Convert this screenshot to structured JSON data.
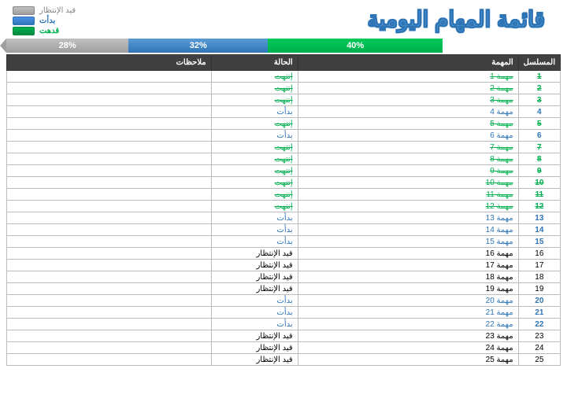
{
  "title": "قائمة المهام اليومية",
  "legend": {
    "pending": "قيد الإنتظار",
    "started": "بدأت",
    "done": "قدهت"
  },
  "progress": {
    "green": "40%",
    "blue": "32%",
    "gray": "28%"
  },
  "columns": {
    "seq": "المسلسل",
    "task": "المهمة",
    "status": "الحالة",
    "notes": "ملاحظات"
  },
  "status_labels": {
    "done": "إنتهت",
    "started": "بدأت",
    "pending": "قيد الإنتظار"
  },
  "rows": [
    {
      "n": 1,
      "task": "مهمة 1",
      "s": "done"
    },
    {
      "n": 2,
      "task": "مهمة 2",
      "s": "done"
    },
    {
      "n": 3,
      "task": "مهمة 3",
      "s": "done"
    },
    {
      "n": 4,
      "task": "مهمة 4",
      "s": "started"
    },
    {
      "n": 5,
      "task": "مهمة 5",
      "s": "done"
    },
    {
      "n": 6,
      "task": "مهمة 6",
      "s": "started"
    },
    {
      "n": 7,
      "task": "مهمة 7",
      "s": "done"
    },
    {
      "n": 8,
      "task": "مهمة 8",
      "s": "done"
    },
    {
      "n": 9,
      "task": "مهمة 9",
      "s": "done"
    },
    {
      "n": 10,
      "task": "مهمة 10",
      "s": "done"
    },
    {
      "n": 11,
      "task": "مهمة 11",
      "s": "done"
    },
    {
      "n": 12,
      "task": "مهمة 12",
      "s": "done"
    },
    {
      "n": 13,
      "task": "مهمة 13",
      "s": "started"
    },
    {
      "n": 14,
      "task": "مهمة 14",
      "s": "started"
    },
    {
      "n": 15,
      "task": "مهمة 15",
      "s": "started"
    },
    {
      "n": 16,
      "task": "مهمة 16",
      "s": "pending"
    },
    {
      "n": 17,
      "task": "مهمة 17",
      "s": "pending"
    },
    {
      "n": 18,
      "task": "مهمة 18",
      "s": "pending"
    },
    {
      "n": 19,
      "task": "مهمة 19",
      "s": "pending"
    },
    {
      "n": 20,
      "task": "مهمة 20",
      "s": "started"
    },
    {
      "n": 21,
      "task": "مهمة 21",
      "s": "started"
    },
    {
      "n": 22,
      "task": "مهمة 22",
      "s": "started"
    },
    {
      "n": 23,
      "task": "مهمة 23",
      "s": "pending"
    },
    {
      "n": 24,
      "task": "مهمة 24",
      "s": "pending"
    },
    {
      "n": 25,
      "task": "مهمة 25",
      "s": "pending"
    }
  ]
}
